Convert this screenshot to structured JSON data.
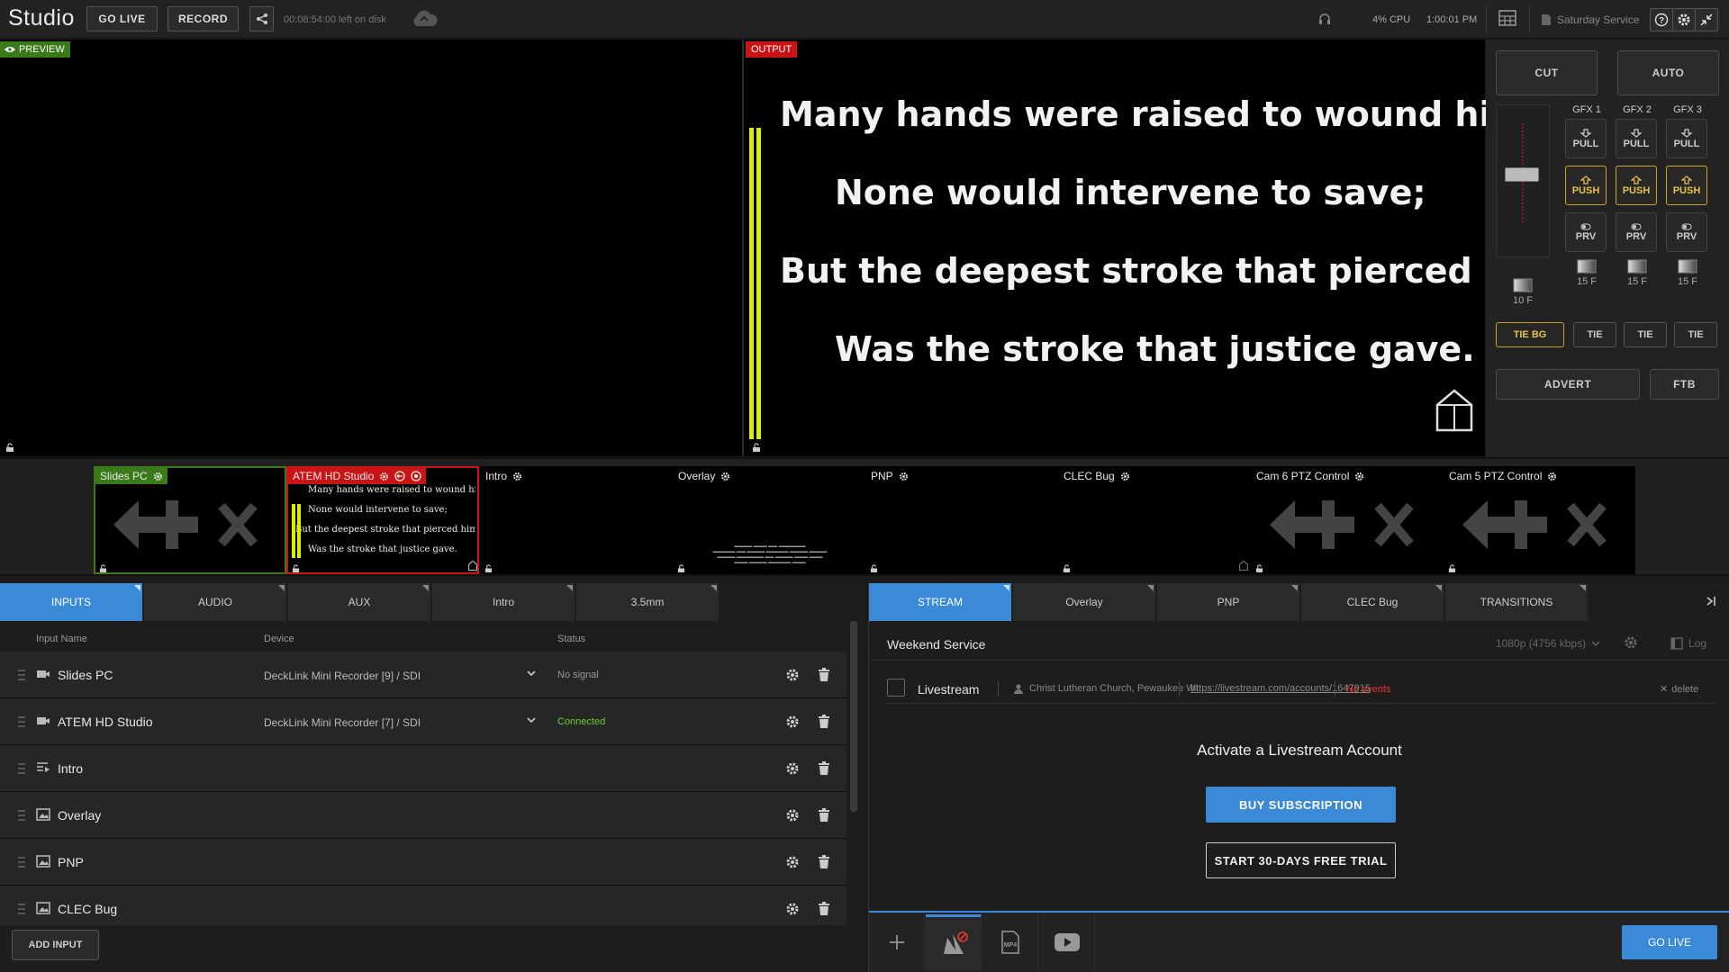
{
  "topbar": {
    "app_title": "Studio",
    "go_live_label": "GO LIVE",
    "record_label": "RECORD",
    "disk_text": "00:08:54:00 left on disk",
    "cpu_text": "4% CPU",
    "clock_text": "1:00:01 PM",
    "project_name": "Saturday Service"
  },
  "preview": {
    "badge": "PREVIEW"
  },
  "output": {
    "badge": "OUTPUT",
    "lyrics": [
      "Many hands were raised to wound him,",
      "None would intervene to save;",
      "But the deepest stroke that pierced him",
      "Was the stroke that justice gave."
    ]
  },
  "switcher": {
    "cut_label": "CUT",
    "auto_label": "AUTO",
    "main_frames": "10 F",
    "gfx": [
      {
        "label": "GFX 1",
        "pull": "PULL",
        "push": "PUSH",
        "prv": "PRV",
        "frames": "15 F"
      },
      {
        "label": "GFX 2",
        "pull": "PULL",
        "push": "PUSH",
        "prv": "PRV",
        "frames": "15 F"
      },
      {
        "label": "GFX 3",
        "pull": "PULL",
        "push": "PUSH",
        "prv": "PRV",
        "frames": "15 F"
      }
    ],
    "tie_bg_label": "TIE BG",
    "tie_label": "TIE",
    "advert_label": "ADVERT",
    "ftb_label": "FTB",
    "colors": {
      "accent": "#c9a227",
      "program": "#c81414",
      "preview": "#3a7a1a",
      "brand": "#3b8ad8"
    }
  },
  "multiview": {
    "sources": [
      {
        "name": "Slides PC",
        "state": "preview",
        "content": "no-signal"
      },
      {
        "name": "ATEM HD Studio",
        "state": "program",
        "content": "lyrics"
      },
      {
        "name": "Intro",
        "state": "none",
        "content": "blank"
      },
      {
        "name": "Overlay",
        "state": "none",
        "content": "credits"
      },
      {
        "name": "PNP",
        "state": "none",
        "content": "blank"
      },
      {
        "name": "CLEC Bug",
        "state": "none",
        "content": "blank"
      },
      {
        "name": "Cam 6 PTZ Control",
        "state": "none",
        "content": "no-signal"
      },
      {
        "name": "Cam 5 PTZ Control",
        "state": "none",
        "content": "no-signal"
      }
    ],
    "atem_lyrics": [
      "Many hands were raised to wound him,",
      "None would intervene to save;",
      "But the deepest stroke that pierced him",
      "Was the stroke that justice gave."
    ]
  },
  "inputs_panel": {
    "tabs": [
      "INPUTS",
      "AUDIO",
      "AUX",
      "Intro",
      "3.5mm"
    ],
    "active_tab": "INPUTS",
    "headers": {
      "name": "Input Name",
      "device": "Device",
      "status": "Status"
    },
    "rows": [
      {
        "name": "Slides PC",
        "icon": "camera-icon",
        "device": "DeckLink Mini Recorder [9] / SDI",
        "status": "No signal"
      },
      {
        "name": "ATEM HD Studio",
        "icon": "camera-icon",
        "device": "DeckLink Mini Recorder [7] / SDI",
        "status": "Connected"
      },
      {
        "name": "Intro",
        "icon": "playlist-icon",
        "device": "",
        "status": ""
      },
      {
        "name": "Overlay",
        "icon": "image-icon",
        "device": "",
        "status": ""
      },
      {
        "name": "PNP",
        "icon": "image-icon",
        "device": "",
        "status": ""
      },
      {
        "name": "CLEC Bug",
        "icon": "image-icon",
        "device": "",
        "status": ""
      }
    ],
    "add_input_label": "ADD INPUT"
  },
  "stream_panel": {
    "tabs": [
      "STREAM",
      "Overlay",
      "PNP",
      "CLEC Bug",
      "TRANSITIONS"
    ],
    "active_tab": "STREAM",
    "profile_name": "Weekend Service",
    "quality": "1080p (4756 kbps)",
    "log_label": "Log",
    "destination": {
      "name": "Livestream",
      "account": "Christ Lutheran Church, Pewaukee WI",
      "url": "https://livestream.com/accounts/1647915",
      "events": "No events",
      "delete_label": "delete"
    },
    "activate_title": "Activate a Livestream Account",
    "buy_label": "BUY SUBSCRIPTION",
    "trial_label": "START 30-DAYS FREE TRIAL",
    "go_live_label": "GO LIVE"
  }
}
